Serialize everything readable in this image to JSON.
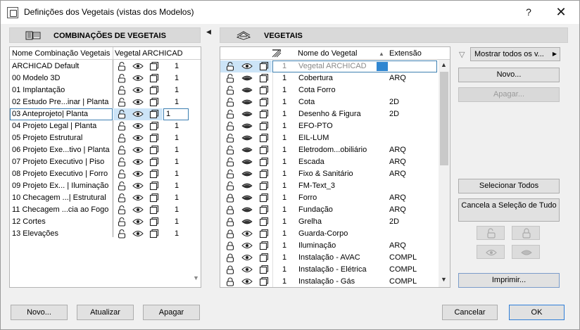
{
  "window": {
    "title": "Definições dos Vegetais (vistas dos Modelos)",
    "help_label": "?",
    "close_label": "✕"
  },
  "left_panel": {
    "header": "COMBINAÇÕES DE VEGETAIS",
    "col_name": "Nome Combinação Vegetais",
    "col_layer": "Vegetal ARCHICAD",
    "rows": [
      {
        "name": "ARCHICAD Default",
        "count": "1"
      },
      {
        "name": "00 Modelo 3D",
        "count": "1"
      },
      {
        "name": "01 Implantação",
        "count": "1"
      },
      {
        "name": "02 Estudo Pre...inar | Planta",
        "count": "1"
      },
      {
        "name": "03 Anteprojeto| Planta",
        "count": "1"
      },
      {
        "name": "04 Projeto Legal | Planta",
        "count": "1"
      },
      {
        "name": "05 Projeto Estrutural",
        "count": "1"
      },
      {
        "name": "06 Projeto Exe...tivo | Planta",
        "count": "1"
      },
      {
        "name": "07 Projeto Executivo | Piso",
        "count": "1"
      },
      {
        "name": "08 Projeto Executivo | Forro",
        "count": "1"
      },
      {
        "name": "09 Projeto Ex... | Iluminação",
        "count": "1"
      },
      {
        "name": "10 Checagem ...| Estrutural",
        "count": "1"
      },
      {
        "name": "11 Checagem ...cia ao Fogo",
        "count": "1"
      },
      {
        "name": "12 Cortes",
        "count": "1"
      },
      {
        "name": "13 Elevações",
        "count": "1"
      }
    ],
    "selected_index": 4,
    "buttons": {
      "new": "Novo...",
      "update": "Atualizar",
      "delete": "Apagar"
    }
  },
  "right_panel": {
    "header": "VEGETAIS",
    "col_name": "Nome do Vegetal",
    "col_ext": "Extensão",
    "rows": [
      {
        "num": "1",
        "name": "Vegetal ARCHICAD",
        "ext": "",
        "lock": "open",
        "eye": "open"
      },
      {
        "num": "1",
        "name": "Cobertura",
        "ext": "ARQ",
        "lock": "open",
        "eye": "closed"
      },
      {
        "num": "1",
        "name": "Cota Forro",
        "ext": "",
        "lock": "open",
        "eye": "closed"
      },
      {
        "num": "1",
        "name": "Cota",
        "ext": "2D",
        "lock": "open",
        "eye": "closed"
      },
      {
        "num": "1",
        "name": "Desenho & Figura",
        "ext": "2D",
        "lock": "open",
        "eye": "closed"
      },
      {
        "num": "1",
        "name": "EFO-PTO",
        "ext": "",
        "lock": "open",
        "eye": "closed"
      },
      {
        "num": "1",
        "name": "EIL-LUM",
        "ext": "",
        "lock": "open",
        "eye": "closed"
      },
      {
        "num": "1",
        "name": "Eletrodom...obiliário",
        "ext": "ARQ",
        "lock": "open",
        "eye": "closed"
      },
      {
        "num": "1",
        "name": "Escada",
        "ext": "ARQ",
        "lock": "open",
        "eye": "closed"
      },
      {
        "num": "1",
        "name": "Fixo & Sanitário",
        "ext": "ARQ",
        "lock": "open",
        "eye": "closed"
      },
      {
        "num": "1",
        "name": "FM-Text_3",
        "ext": "",
        "lock": "open",
        "eye": "closed"
      },
      {
        "num": "1",
        "name": "Forro",
        "ext": "ARQ",
        "lock": "closed",
        "eye": "closed"
      },
      {
        "num": "1",
        "name": "Fundação",
        "ext": "ARQ",
        "lock": "closed",
        "eye": "closed"
      },
      {
        "num": "1",
        "name": "Grelha",
        "ext": "2D",
        "lock": "closed",
        "eye": "closed"
      },
      {
        "num": "1",
        "name": "Guarda-Corpo",
        "ext": "",
        "lock": "closed",
        "eye": "open"
      },
      {
        "num": "1",
        "name": "Iluminação",
        "ext": "ARQ",
        "lock": "closed",
        "eye": "open"
      },
      {
        "num": "1",
        "name": "Instalação - AVAC",
        "ext": "COMPL",
        "lock": "closed",
        "eye": "open"
      },
      {
        "num": "1",
        "name": "Instalação - Elétrica",
        "ext": "COMPL",
        "lock": "closed",
        "eye": "open"
      },
      {
        "num": "1",
        "name": "Instalação - Gás",
        "ext": "COMPL",
        "lock": "closed",
        "eye": "open"
      }
    ],
    "filter_label": "Mostrar todos os v...",
    "buttons": {
      "new": "Novo...",
      "delete": "Apagar...",
      "select_all": "Selecionar Todos",
      "deselect_all": "Cancela a Seleção de Tudo",
      "print": "Imprimir...",
      "cancel": "Cancelar",
      "ok": "OK"
    }
  }
}
